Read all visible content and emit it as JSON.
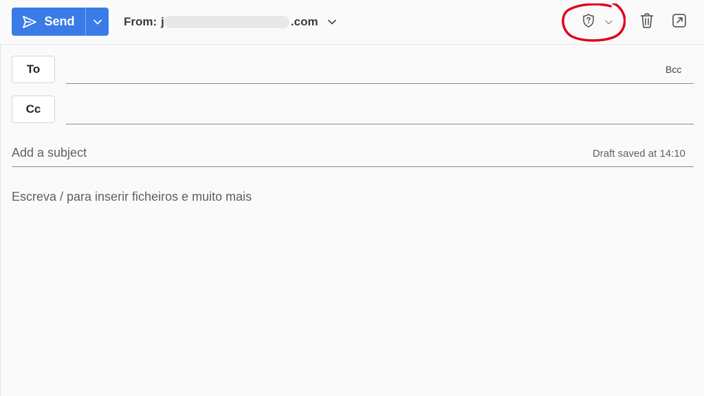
{
  "colors": {
    "accent": "#3a7be8",
    "annotation": "#e0001b"
  },
  "toolbar": {
    "send_label": "Send",
    "from_label": "From:",
    "from_visible_prefix": "j",
    "from_visible_suffix": ".com",
    "icons": {
      "send": "paper-plane-icon",
      "send_dropdown": "chevron-down-icon",
      "from_dropdown": "chevron-down-icon",
      "sensitivity": "shield-question-icon",
      "sensitivity_dropdown": "chevron-down-icon",
      "discard": "trash-icon",
      "popout": "open-in-new-window-icon"
    }
  },
  "recipients": {
    "to_label": "To",
    "cc_label": "Cc",
    "bcc_label": "Bcc"
  },
  "subject": {
    "placeholder": "Add a subject",
    "draft_status": "Draft saved at 14:10"
  },
  "body": {
    "placeholder": "Escreva / para inserir ficheiros e muito mais"
  }
}
